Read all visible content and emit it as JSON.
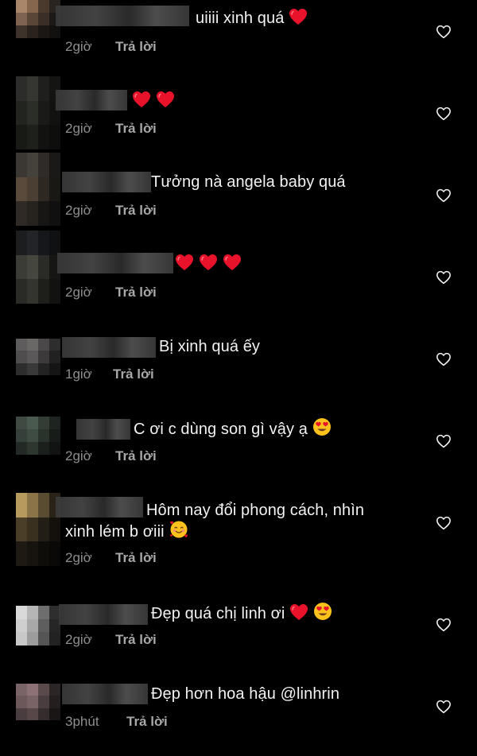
{
  "comments": [
    {
      "text": "uiiii xinh quá",
      "time": "2giờ",
      "reply": "Trả lời"
    },
    {
      "text": "",
      "time": "2giờ",
      "reply": "Trả lời"
    },
    {
      "text": "Tưởng nà angela baby quá",
      "time": "2giờ",
      "reply": "Trả lời"
    },
    {
      "text": "",
      "time": "2giờ",
      "reply": "Trả lời"
    },
    {
      "text": "Bị xinh quá ếy",
      "time": "1giờ",
      "reply": "Trả lời"
    },
    {
      "text": "C ơi c dùng son gì vậy ạ",
      "time": "2giờ",
      "reply": "Trả lời"
    },
    {
      "text_line1": "Hôm nay đổi phong cách, nhìn",
      "text_line2": "xinh lém b ơiii",
      "time": "2giờ",
      "reply": "Trả lời"
    },
    {
      "text": "Đẹp quá chị linh ơi",
      "time": "2giờ",
      "reply": "Trả lời"
    },
    {
      "text": "Đẹp hơn hoa hậu @linhrin",
      "time": "3phút",
      "reply": "Trả lời"
    }
  ],
  "icons": {
    "like": "heart-outline-icon",
    "red_heart": "red-heart-emoji",
    "heart_eyes": "heart-eyes-emoji",
    "smiling_hearts": "smiling-face-with-hearts-emoji"
  },
  "colors": {
    "background": "#000000",
    "text": "#f2f2f2",
    "meta": "#8e8e8e",
    "heart": "#e8132b"
  }
}
